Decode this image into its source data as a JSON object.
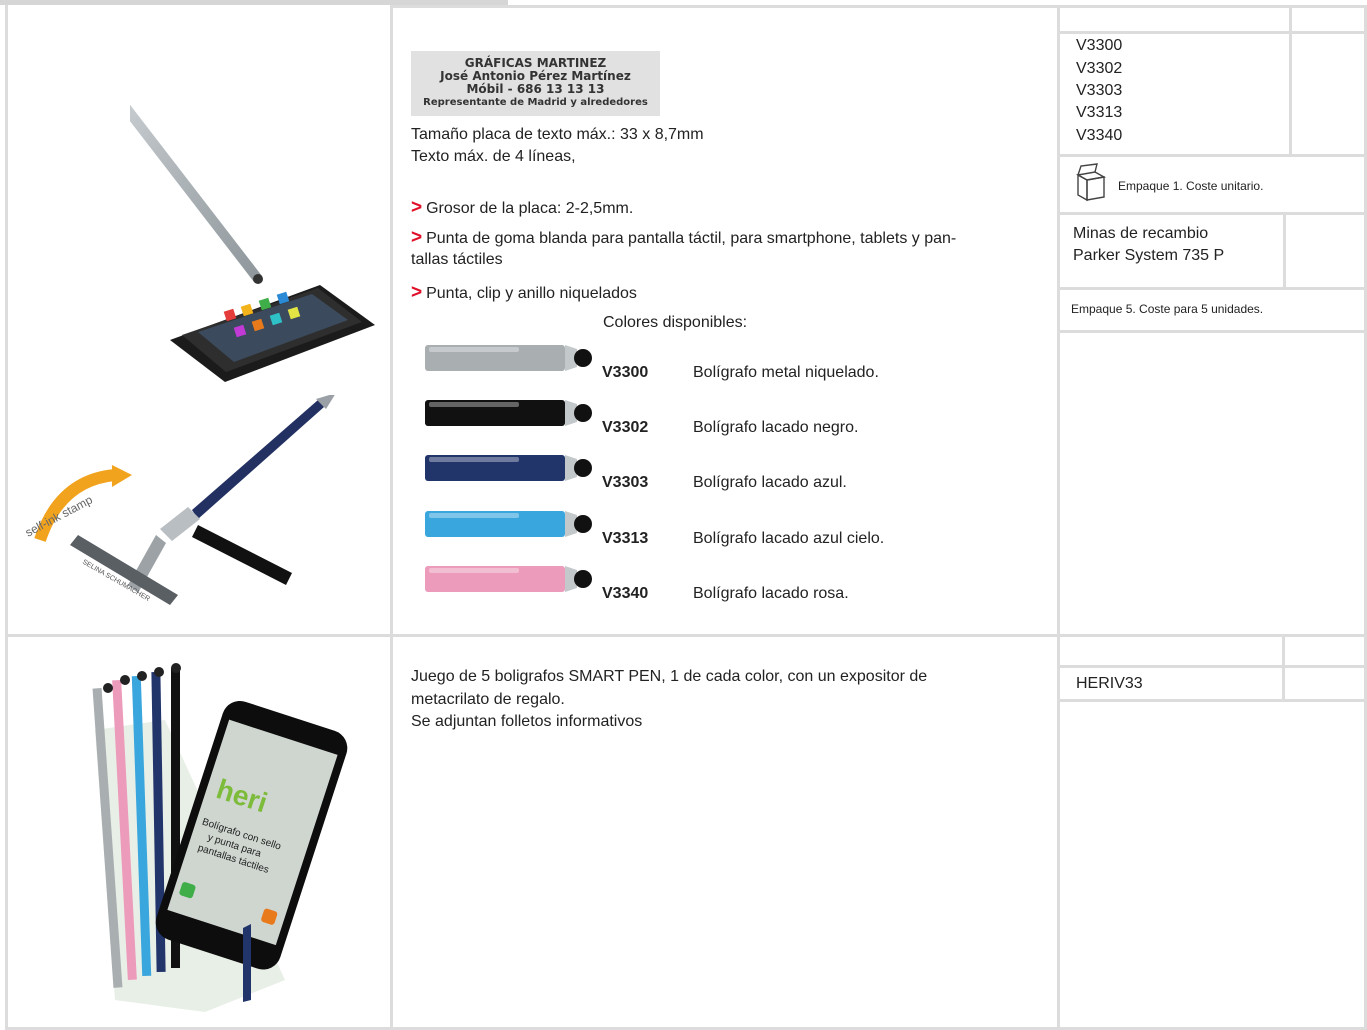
{
  "stamp": {
    "lines": [
      "GRÁFICAS MARTINEZ",
      "José Antonio Pérez Martínez",
      "Móbil - 686 13 13 13",
      "Representante de Madrid y alrededores"
    ]
  },
  "product1": {
    "image_texts": {
      "curve": "self-ink stamp",
      "stamp_name": "SELINA SCHUMACHER"
    },
    "spec_lines": [
      "Tamaño placa de texto máx.: 33 x 8,7mm",
      "Texto máx. de 4 líneas,"
    ],
    "bullets": [
      "Grosor de la placa: 2-2,5mm.",
      "Punta de goma blanda para pantalla táctil, para smartphone, tablets y pan-",
      "tallas táctiles",
      "Punta, clip y anillo niquelados"
    ],
    "bullet_marker": ">",
    "colors_heading": "Colores disponibles:",
    "variants": [
      {
        "code": "V3300",
        "desc": "Bolígrafo metal niquelado.",
        "color": "#a9aeb1"
      },
      {
        "code": "V3302",
        "desc": "Bolígrafo lacado negro.",
        "color": "#111111"
      },
      {
        "code": "V3303",
        "desc": "Bolígrafo lacado azul.",
        "color": "#22356b"
      },
      {
        "code": "V3313",
        "desc": "Bolígrafo lacado azul cielo.",
        "color": "#3aa6de"
      },
      {
        "code": "V3340",
        "desc": "Bolígrafo lacado rosa.",
        "color": "#ec9bbb"
      }
    ],
    "ref_codes": [
      "V3300",
      "V3302",
      "V3303",
      "V3313",
      "V3340"
    ],
    "pack_note": "Empaque 1. Coste unitario.",
    "refill_lines": [
      "Minas de recambio",
      "Parker System 735 P"
    ],
    "pack5_note": "Empaque 5. Coste para 5 unidades."
  },
  "product2": {
    "image_texts": {
      "brand": "heri",
      "tagline": [
        "Bolígrafo con sello",
        "y punta para",
        "pantallas táctiles"
      ]
    },
    "desc_lines": [
      "Juego de 5 boligrafos SMART PEN, 1 de cada color, con un expositor de",
      "metacrilato de regalo.",
      "Se adjuntan folletos informativos"
    ],
    "ref_code": "HERIV33"
  },
  "colors": {
    "rule": "#dcdcdc",
    "accent_red": "#e0102a",
    "logo_bg": "#e1e1e1"
  }
}
